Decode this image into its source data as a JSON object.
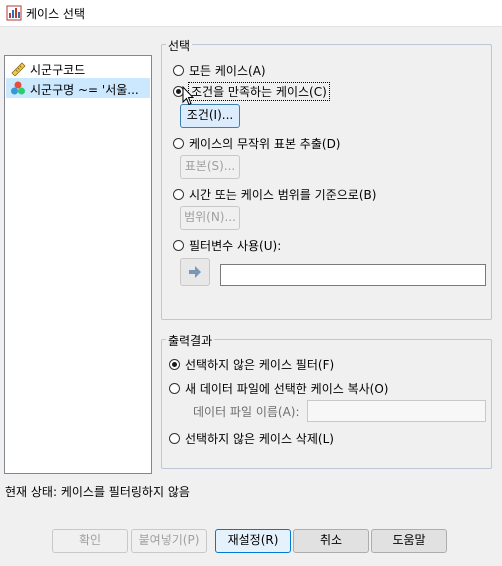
{
  "window": {
    "title": "케이스 선택"
  },
  "variables": [
    {
      "label": "시군구코드",
      "icon": "ruler-icon"
    },
    {
      "label": "시군구명  ~= '서울...",
      "icon": "nominal-icon"
    }
  ],
  "selection": {
    "legend": "선택",
    "options": {
      "all": "모든 케이스(A)",
      "condition": "조건을 만족하는 케이스(C)",
      "random": "케이스의 무작위 표본 추출(D)",
      "range": "시간 또는 케이스 범위를 기준으로(B)",
      "filter": "필터변수 사용(U):"
    },
    "buttons": {
      "condition": "조건(I)...",
      "sample": "표본(S)...",
      "range": "범위(N)..."
    },
    "selected": "condition"
  },
  "output": {
    "legend": "출력결과",
    "options": {
      "filter_out": "선택하지 않은 케이스 필터(F)",
      "copy": "새 데이터 파일에 선택한 케이스 복사(O)",
      "delete": "선택하지 않은 케이스 삭제(L)"
    },
    "dataset_label": "데이터 파일 이름(A):",
    "selected": "filter_out"
  },
  "status": "현재 상태: 케이스를 필터링하지 않음",
  "footer": {
    "ok": "확인",
    "paste": "붙여넣기(P)",
    "reset": "재설정(R)",
    "cancel": "취소",
    "help": "도움말"
  }
}
